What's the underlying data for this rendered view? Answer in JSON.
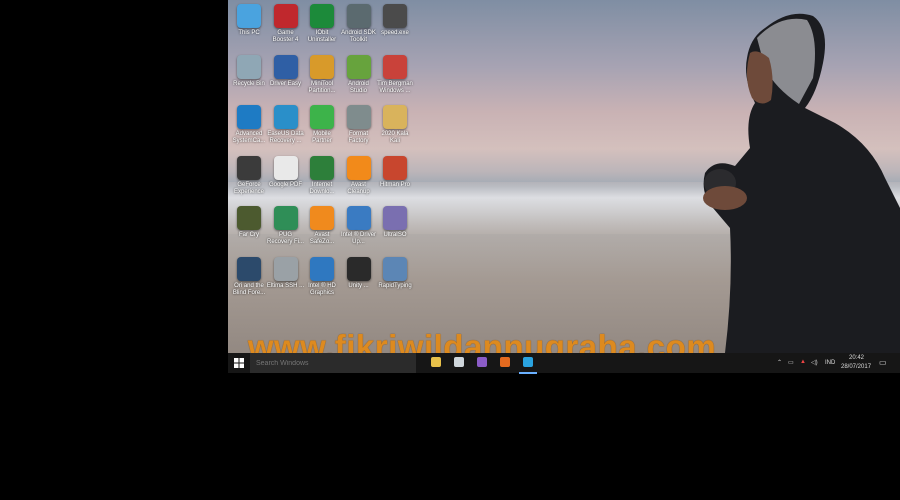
{
  "desktop": {
    "icons": [
      {
        "label": "This PC",
        "icon": "this-pc-icon",
        "color": "#4aa3df"
      },
      {
        "label": "Game Booster 4",
        "icon": "game-booster-icon",
        "color": "#c0282d"
      },
      {
        "label": "IObit Uninstaller",
        "icon": "iobit-uninstaller-icon",
        "color": "#1c8a3a"
      },
      {
        "label": "Android SDK Toolkit",
        "icon": "android-sdk-icon",
        "color": "#5b6a6f"
      },
      {
        "label": "speed.exe",
        "icon": "nfs-icon",
        "color": "#4b4b4b"
      },
      {
        "label": "Recycle Bin",
        "icon": "recycle-bin-icon",
        "color": "#8fa7b5"
      },
      {
        "label": "Driver Easy",
        "icon": "driver-easy-icon",
        "color": "#2f5fa5"
      },
      {
        "label": "MiniTool Partition...",
        "icon": "minitool-partition-icon",
        "color": "#d89a2a"
      },
      {
        "label": "Android Studio",
        "icon": "android-studio-icon",
        "color": "#67a33d"
      },
      {
        "label": "Tim Bergman Windows ...",
        "icon": "windows-tool-icon",
        "color": "#c9423a"
      },
      {
        "label": "Advanced SystemCa...",
        "icon": "advanced-systemcare-icon",
        "color": "#1e7bc4"
      },
      {
        "label": "EaseUS Data Recovery ...",
        "icon": "easeus-recovery-icon",
        "color": "#2a8fc9"
      },
      {
        "label": "Mobile Partner",
        "icon": "mobile-partner-icon",
        "color": "#3db34a"
      },
      {
        "label": "Format Factory",
        "icon": "format-factory-icon",
        "color": "#7f8c8d"
      },
      {
        "label": "2020 Kala Kali",
        "icon": "folder-icon",
        "color": "#d9b35c"
      },
      {
        "label": "GeForce Experience",
        "icon": "geforce-icon",
        "color": "#3b3b3b"
      },
      {
        "label": "Google PDF",
        "icon": "document-icon",
        "color": "#e9e9e9"
      },
      {
        "label": "Internet Downlo...",
        "icon": "internet-download-icon",
        "color": "#2d7f3a"
      },
      {
        "label": "Avast Cleanup",
        "icon": "avast-cleanup-icon",
        "color": "#f28a1a"
      },
      {
        "label": "Hitman Pro",
        "icon": "hitmanpro-icon",
        "color": "#c8462e"
      },
      {
        "label": "Far Cry",
        "icon": "far-cry-icon",
        "color": "#4c5a2f"
      },
      {
        "label": "PUG Recovery Fi...",
        "icon": "recovery-icon",
        "color": "#2f8e57"
      },
      {
        "label": "Avast SafeZo...",
        "icon": "avast-safezone-icon",
        "color": "#f08a1d"
      },
      {
        "label": "Intel ® Driver Up...",
        "icon": "intel-driver-icon",
        "color": "#3a7bc2"
      },
      {
        "label": "UltraISO",
        "icon": "ultraiso-icon",
        "color": "#7a6fb0"
      },
      {
        "label": "Ori and the Blind Fore...",
        "icon": "ori-game-icon",
        "color": "#2c4a6b"
      },
      {
        "label": "Eltima SSH ...",
        "icon": "eltima-icon",
        "color": "#9aa1a6"
      },
      {
        "label": "Intel ® HD Graphics",
        "icon": "intel-graphics-icon",
        "color": "#2f78c0"
      },
      {
        "label": "Unity ...",
        "icon": "unity-icon",
        "color": "#2a2a2a"
      },
      {
        "label": "RapidTyping",
        "icon": "rapidtyping-icon",
        "color": "#5c86b5"
      }
    ]
  },
  "watermark": "www.fikriwildannugraha.com",
  "taskbar": {
    "search_placeholder": "Search Windows",
    "pinned": [
      {
        "name": "file-explorer-icon",
        "color": "#e8c14a"
      },
      {
        "name": "alien-app-icon",
        "color": "#cfd6db"
      },
      {
        "name": "visual-studio-icon",
        "color": "#8b5cc7"
      },
      {
        "name": "firefox-icon",
        "color": "#e46a1f"
      },
      {
        "name": "photoshop-icon",
        "color": "#2aa3e0"
      }
    ],
    "tray": {
      "language": "IND",
      "time": "20:42",
      "date": "28/07/2017"
    }
  }
}
